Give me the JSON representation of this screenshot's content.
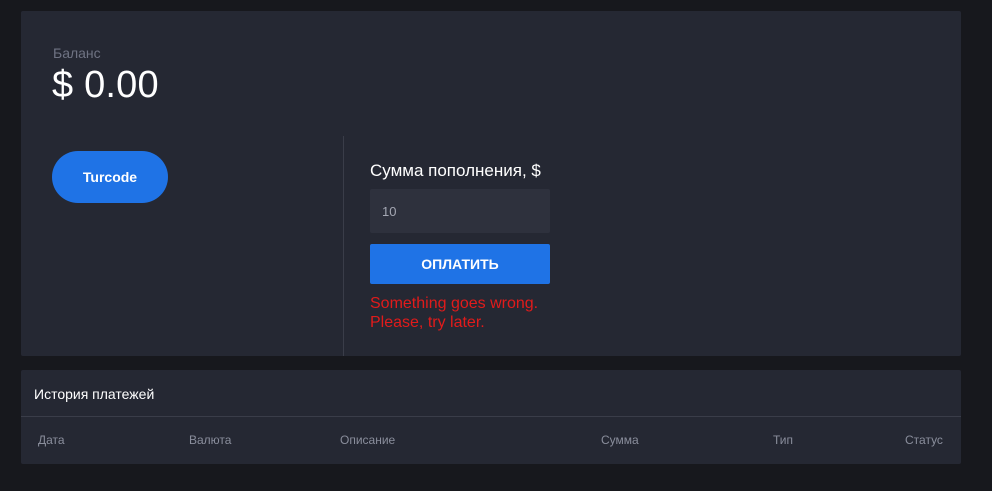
{
  "balance": {
    "label": "Баланс",
    "value": "$ 0.00"
  },
  "providers": {
    "button_label": "Turcode"
  },
  "topup": {
    "amount_label": "Сумма пополнения, $",
    "amount_value": "10",
    "pay_label": "ОПЛАТИТЬ",
    "error_line1": "Something goes wrong.",
    "error_line2": "Please, try later."
  },
  "history": {
    "title": "История платежей",
    "columns": [
      "Дата",
      "Валюта",
      "Описание",
      "Сумма",
      "Тип",
      "Статус"
    ]
  },
  "colors": {
    "background": "#17181d",
    "card": "#252833",
    "accent": "#1f73e6",
    "error": "#e11b1b"
  }
}
